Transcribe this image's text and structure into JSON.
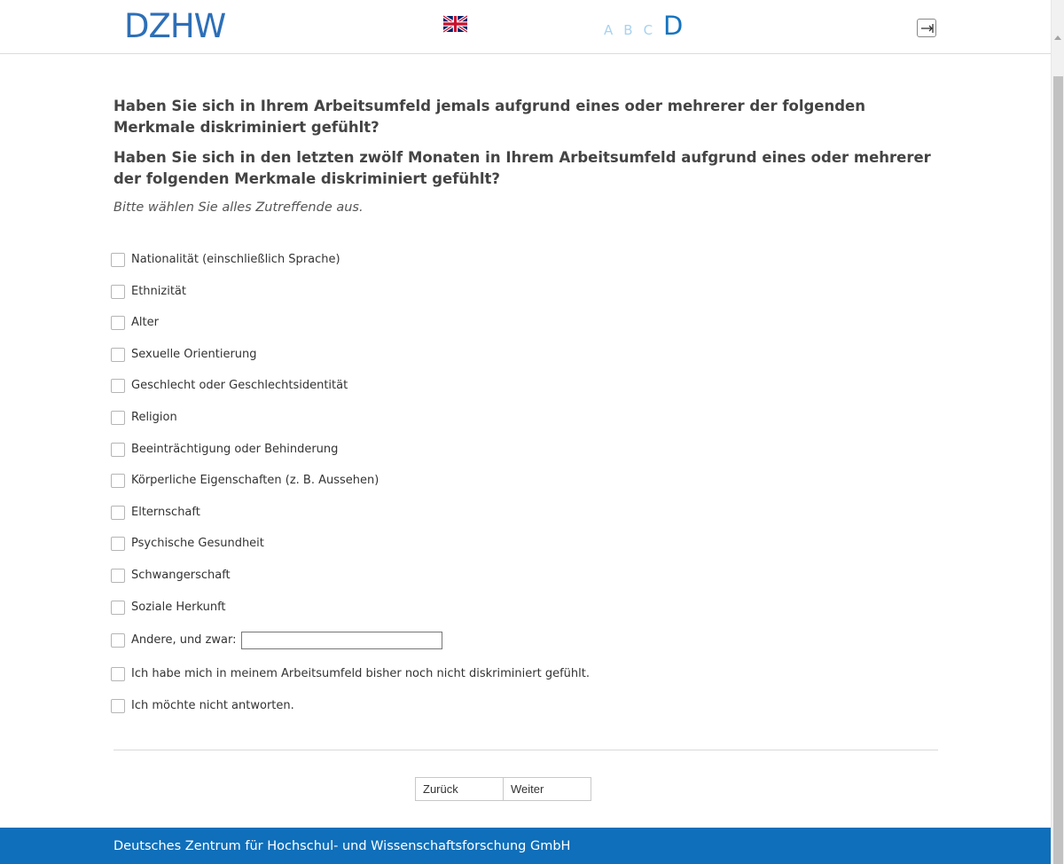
{
  "header": {
    "logo_text": "DZHW",
    "language_flag": "uk-flag-icon",
    "progress_letters": [
      "A",
      "B",
      "C"
    ],
    "progress_active": "D"
  },
  "question": {
    "title_1": "Haben Sie sich in Ihrem Arbeitsumfeld jemals aufgrund eines oder mehrerer der folgenden Merkmale diskriminiert gefühlt?",
    "title_2": "Haben Sie sich in den letzten zwölf Monaten in Ihrem Arbeitsumfeld aufgrund eines oder mehrerer der folgenden Merkmale diskriminiert gefühlt?",
    "instruction": "Bitte wählen Sie alles Zutreffende aus."
  },
  "options": [
    "Nationalität (einschließlich Sprache)",
    "Ethnizität",
    "Alter",
    "Sexuelle Orientierung",
    "Geschlecht oder Geschlechtsidentität",
    "Religion",
    "Beeinträchtigung oder Behinderung",
    "Körperliche Eigenschaften (z. B. Aussehen)",
    "Elternschaft",
    "Psychische Gesundheit",
    "Schwangerschaft",
    "Soziale Herkunft",
    "Andere, und zwar:",
    "Ich habe mich in meinem Arbeitsumfeld bisher noch nicht diskriminiert gefühlt.",
    "Ich möchte nicht antworten."
  ],
  "other_input": {
    "value": "",
    "placeholder": ""
  },
  "nav": {
    "back_label": "Zurück",
    "next_label": "Weiter"
  },
  "footer": {
    "text": "Deutsches Zentrum für Hochschul- und Wissenschaftsforschung GmbH"
  },
  "colors": {
    "brand_blue": "#2d6fb7",
    "footer_blue": "#0f6fba",
    "progress_inactive": "#a8d2ef"
  }
}
